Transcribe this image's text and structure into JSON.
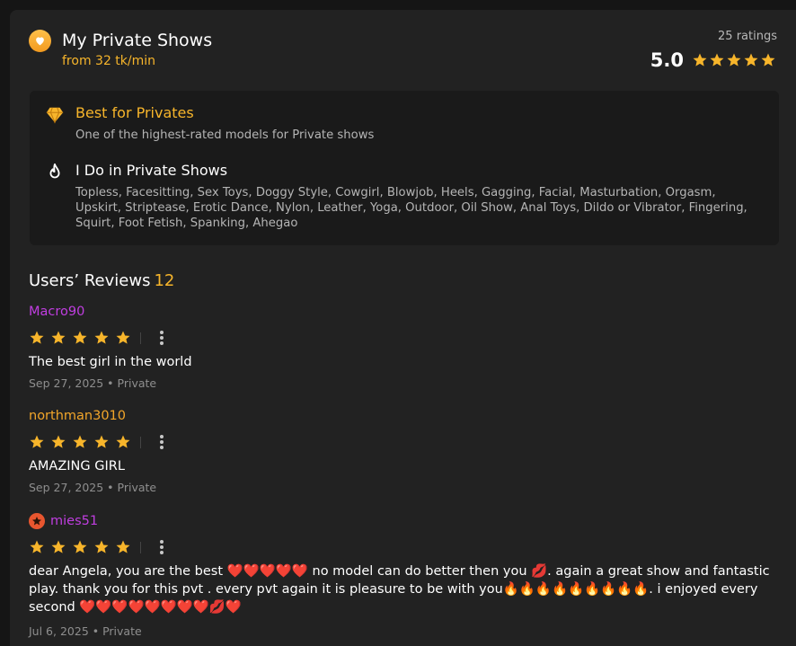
{
  "header": {
    "title": "My Private Shows",
    "price": "from 32 tk/min",
    "ratings_count": "25 ratings",
    "score": "5.0",
    "score_stars": 5
  },
  "features": [
    {
      "icon": "diamond-icon",
      "title": "Best for Privates",
      "title_color": "#f7b52b",
      "text": "One of the highest-rated models for Private shows"
    },
    {
      "icon": "flame-icon",
      "title": "I Do in Private Shows",
      "title_color": "#ffffff",
      "text": "Topless, Facesitting, Sex Toys, Doggy Style, Cowgirl, Blowjob, Heels, Gagging, Facial, Masturbation, Orgasm, Upskirt, Striptease, Erotic Dance, Nylon, Leather, Yoga, Outdoor, Oil Show, Anal Toys, Dildo or Vibrator, Fingering, Squirt, Foot Fetish, Spanking, Ahegao"
    }
  ],
  "reviews_section": {
    "heading": "Users’ Reviews",
    "count": "12"
  },
  "reviews": [
    {
      "username": "Macro90",
      "username_color": "#c03ee0",
      "has_badge": false,
      "stars": 5,
      "text": "The best girl in the world",
      "meta": "Sep 27, 2025 • Private"
    },
    {
      "username": "northman3010",
      "username_color": "#f3a62a",
      "has_badge": false,
      "stars": 5,
      "text": "AMAZING GIRL",
      "meta": "Sep 27, 2025 • Private"
    },
    {
      "username": "mies51",
      "username_color": "#c03ee0",
      "has_badge": true,
      "stars": 5,
      "text": "dear Angela, you are the best ❤️❤️❤️❤️❤️ no model can do better then you 💋. again a great show and fantastic play. thank you for this pvt . every pvt again it is pleasure to be with you🔥🔥🔥🔥🔥🔥🔥🔥🔥. i enjoyed every second ❤️❤️❤️❤️❤️❤️❤️❤️💋❤️",
      "meta": "Jul 6, 2025 • Private"
    }
  ],
  "colors": {
    "accent": "#f7b52b",
    "star": "#f7b52b",
    "background": "#222222",
    "panel": "#1a1a1a"
  }
}
